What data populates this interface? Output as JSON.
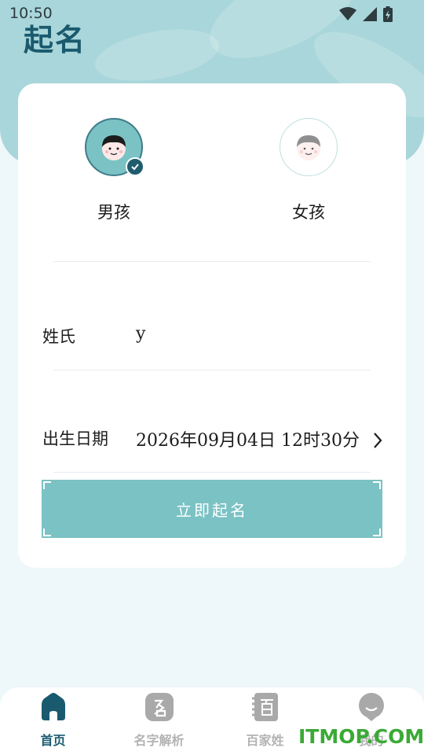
{
  "status_bar": {
    "time": "10:50"
  },
  "header": {
    "title": "起名"
  },
  "gender": {
    "options": [
      {
        "label": "男孩",
        "selected": true
      },
      {
        "label": "女孩",
        "selected": false
      }
    ]
  },
  "form": {
    "surname_label": "姓氏",
    "surname_value": "y",
    "birth_label": "出生日期",
    "birth_value": "2026年09月04日 12时30分"
  },
  "submit_label": "立即起名",
  "bottom_nav": {
    "items": [
      {
        "label": "首页",
        "icon": "home-icon",
        "active": true
      },
      {
        "label": "名字解析",
        "icon": "name-analysis-icon",
        "active": false
      },
      {
        "label": "百家姓",
        "icon": "surnames-book-icon",
        "active": false
      },
      {
        "label": "我的",
        "icon": "profile-icon",
        "active": false
      }
    ]
  },
  "watermark": "ITMOP.COM",
  "colors": {
    "accent": "#7bc2c4",
    "header_bg": "#a9d6da",
    "primary_dark": "#1a5a6e",
    "page_bg": "#eef7f9",
    "inactive": "#b3b3b3",
    "watermark": "#3aaa35"
  }
}
